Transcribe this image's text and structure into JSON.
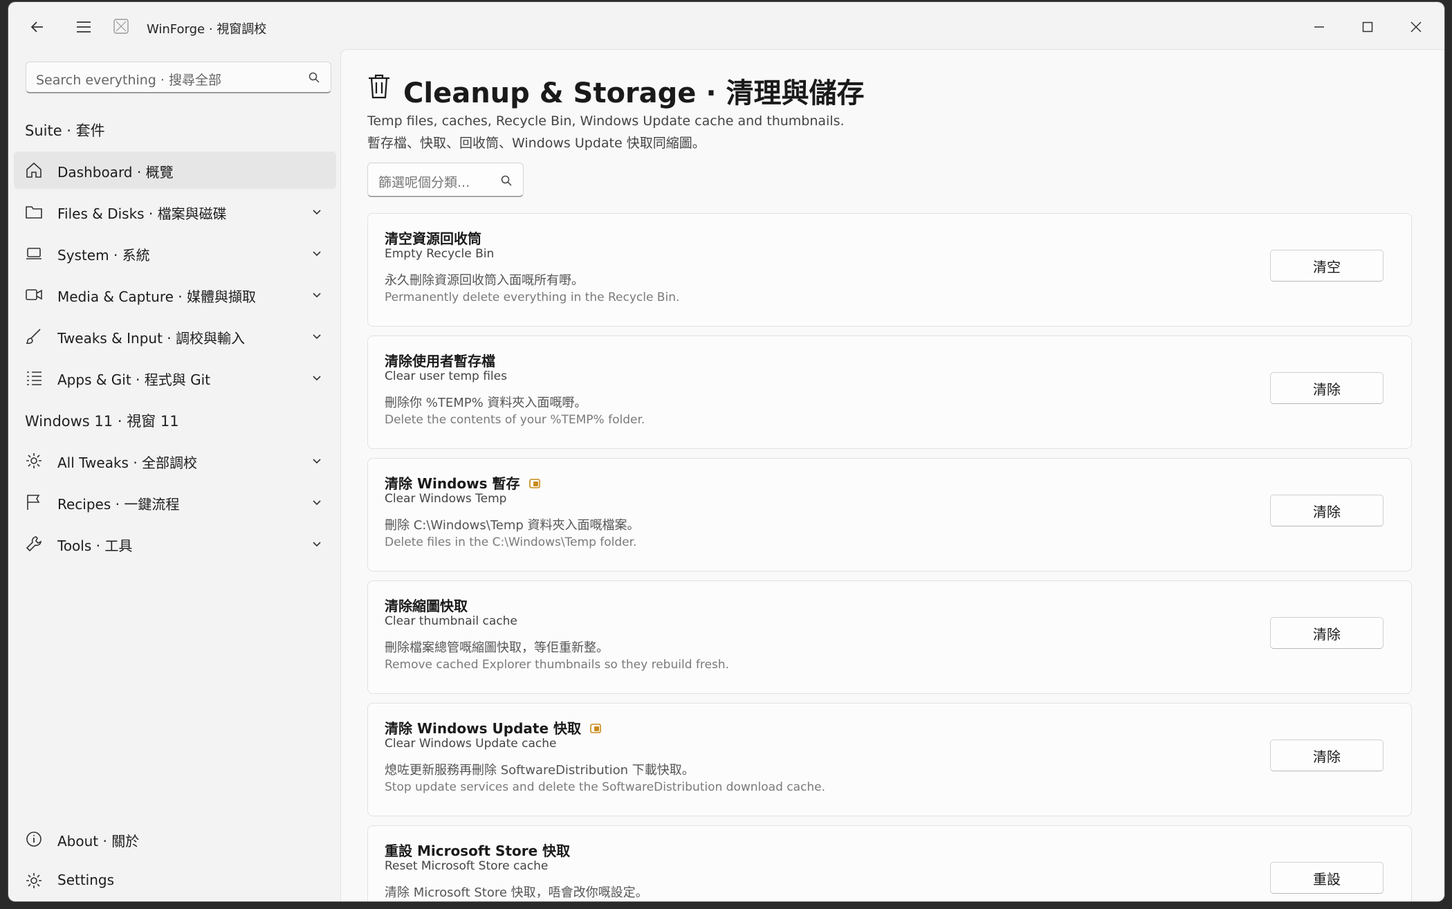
{
  "app": {
    "title": "WinForge · 視窗調校"
  },
  "sidebar": {
    "search_placeholder": "Search everything · 搜尋全部",
    "section1": "Suite · 套件",
    "section2": "Windows 11 · 視窗 11",
    "items": [
      {
        "label": "Dashboard · 概覽",
        "icon": "home-icon"
      },
      {
        "label": "Files & Disks · 檔案與磁碟",
        "icon": "folder-icon"
      },
      {
        "label": "System · 系統",
        "icon": "laptop-icon"
      },
      {
        "label": "Media & Capture · 媒體與擷取",
        "icon": "video-icon"
      },
      {
        "label": "Tweaks & Input · 調校與輸入",
        "icon": "brush-icon"
      },
      {
        "label": "Apps & Git · 程式與 Git",
        "icon": "list-icon"
      },
      {
        "label": "All Tweaks · 全部調校",
        "icon": "gear-icon"
      },
      {
        "label": "Recipes · 一鍵流程",
        "icon": "flag-icon"
      },
      {
        "label": "Tools · 工具",
        "icon": "wrench-icon"
      }
    ],
    "footer": [
      {
        "label": "About · 關於",
        "icon": "info-icon"
      },
      {
        "label": "Settings",
        "icon": "gear-icon"
      }
    ]
  },
  "page": {
    "title": "Cleanup & Storage · 清理與儲存",
    "subtitle_en": "Temp files, caches, Recycle Bin, Windows Update cache and thumbnails.",
    "subtitle_zh": "暫存檔、快取、回收筒、Windows Update 快取同縮圖。",
    "filter_placeholder": "篩選呢個分類..."
  },
  "cards": [
    {
      "title": "清空資源回收筒",
      "subtitle": "Empty Recycle Bin",
      "desc": "永久刪除資源回收筒入面嘅所有嘢。",
      "desc_en": "Permanently delete everything in the Recycle Bin.",
      "button": "清空",
      "admin": false
    },
    {
      "title": "清除使用者暫存檔",
      "subtitle": "Clear user temp files",
      "desc": "刪除你 %TEMP% 資料夾入面嘅嘢。",
      "desc_en": "Delete the contents of your %TEMP% folder.",
      "button": "清除",
      "admin": false
    },
    {
      "title": "清除 Windows 暫存",
      "subtitle": "Clear Windows Temp",
      "desc": "刪除 C:\\Windows\\Temp 資料夾入面嘅檔案。",
      "desc_en": "Delete files in the C:\\Windows\\Temp folder.",
      "button": "清除",
      "admin": true
    },
    {
      "title": "清除縮圖快取",
      "subtitle": "Clear thumbnail cache",
      "desc": "刪除檔案總管嘅縮圖快取，等佢重新整。",
      "desc_en": "Remove cached Explorer thumbnails so they rebuild fresh.",
      "button": "清除",
      "admin": false
    },
    {
      "title": "清除 Windows Update 快取",
      "subtitle": "Clear Windows Update cache",
      "desc": "熄咗更新服務再刪除 SoftwareDistribution 下載快取。",
      "desc_en": "Stop update services and delete the SoftwareDistribution download cache.",
      "button": "清除",
      "admin": true
    },
    {
      "title": "重設 Microsoft Store 快取",
      "subtitle": "Reset Microsoft Store cache",
      "desc": "清除 Microsoft Store 快取，唔會改你嘅設定。",
      "desc_en": "",
      "button": "重設",
      "admin": false
    }
  ],
  "colors": {
    "admin_badge": "#c98a1a",
    "active_item_bg": "#e6e6e6"
  }
}
